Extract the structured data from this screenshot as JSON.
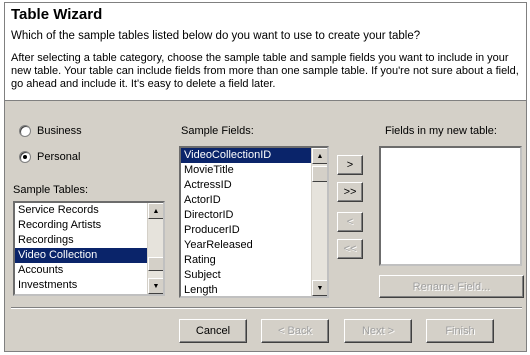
{
  "wizard": {
    "title": "Table Wizard",
    "question": "Which of the sample tables listed below do you want to use to create your table?",
    "description": "After selecting a table category, choose the sample table and sample fields you want to include in your new table. Your table can include fields from more than one sample table. If you're not sure about a field, go ahead and include it. It's easy to delete a field later."
  },
  "category": {
    "business_label": "Business",
    "personal_label": "Personal",
    "selected": "Personal"
  },
  "sample_tables": {
    "label": "Sample Tables:",
    "items": [
      "Service Records",
      "Recording Artists",
      "Recordings",
      "Video Collection",
      "Accounts",
      "Investments"
    ],
    "selected": "Video Collection"
  },
  "sample_fields": {
    "label": "Sample Fields:",
    "items": [
      "VideoCollectionID",
      "MovieTitle",
      "ActressID",
      "ActorID",
      "DirectorID",
      "ProducerID",
      "YearReleased",
      "Rating",
      "Subject",
      "Length"
    ],
    "selected": "VideoCollectionID"
  },
  "new_table": {
    "label": "Fields in my new table:",
    "items": []
  },
  "transfer": {
    "add_one": ">",
    "add_all": ">>",
    "remove_one": "<",
    "remove_all": "<<"
  },
  "buttons": {
    "rename": "Rename Field...",
    "cancel": "Cancel",
    "back": "< Back",
    "next": "Next >",
    "finish": "Finish"
  }
}
